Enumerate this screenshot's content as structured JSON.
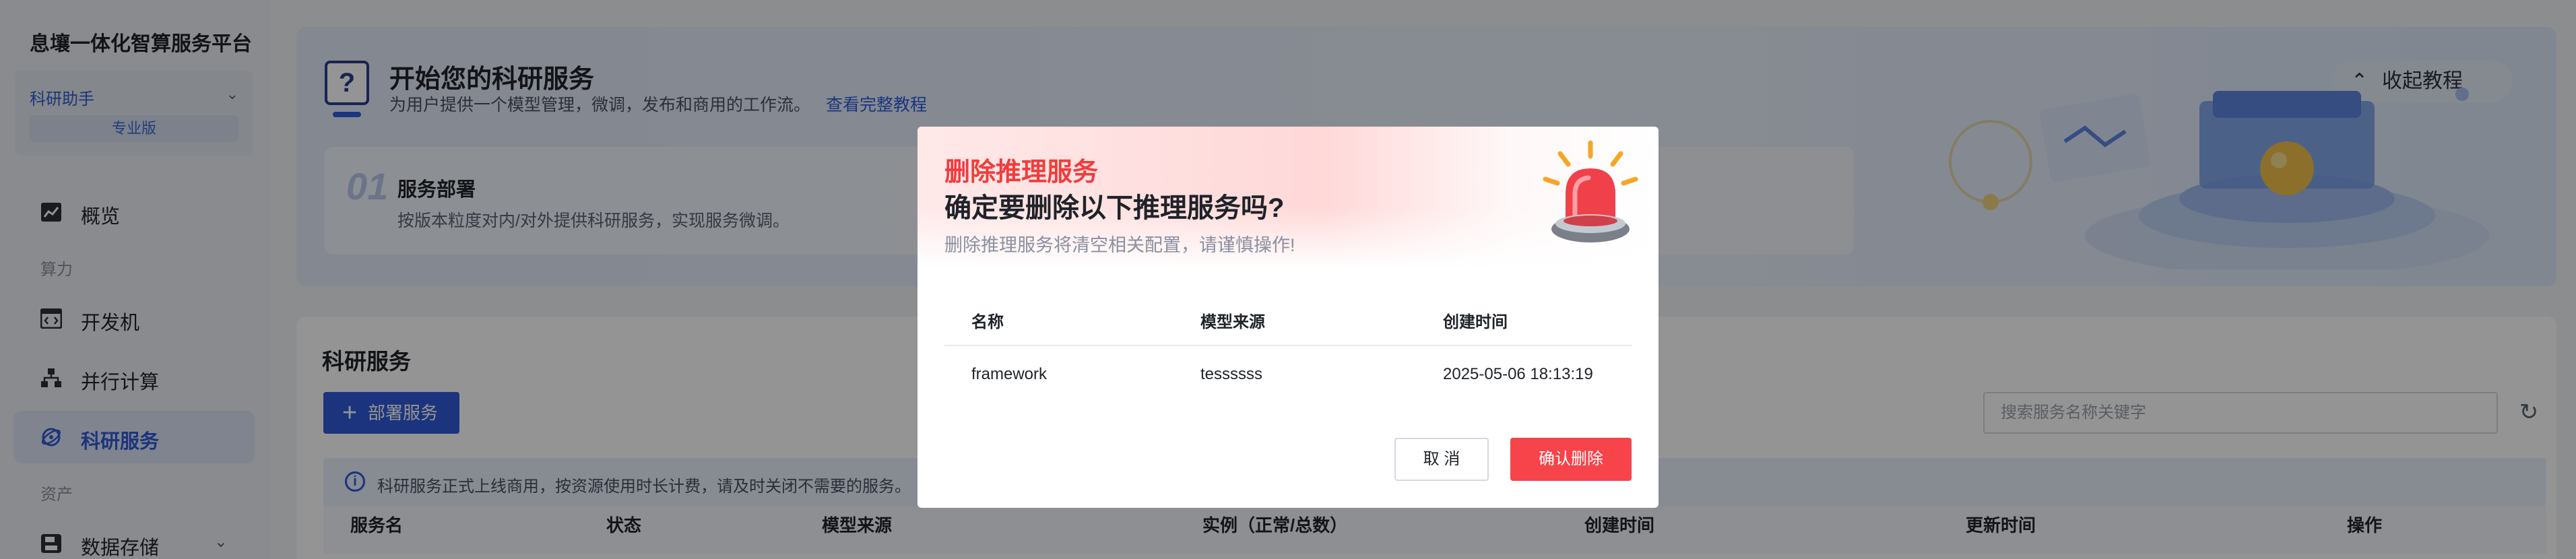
{
  "app": {
    "title": "息壤一体化智算服务平台"
  },
  "workspace": {
    "name": "科研助手",
    "edition": "专业版"
  },
  "sidebar": {
    "items": [
      {
        "label": "概览",
        "icon": "chart-icon"
      },
      {
        "label": "开发机",
        "icon": "code-icon"
      },
      {
        "label": "并行计算",
        "icon": "network-icon"
      },
      {
        "label": "科研服务",
        "icon": "service-icon",
        "active": true
      },
      {
        "label": "数据存储",
        "icon": "disk-icon"
      }
    ],
    "groups": {
      "compute": "算力",
      "assets": "资产"
    }
  },
  "tutorial": {
    "title": "开始您的科研服务",
    "description": "为用户提供一个模型管理，微调，发布和商用的工作流。",
    "link": "查看完整教程",
    "collapse_label": "收起教程",
    "step": {
      "number": "01",
      "title": "服务部署",
      "description": "按版本粒度对内/对外提供科研服务，实现服务微调。"
    }
  },
  "services": {
    "title": "科研服务",
    "deploy_label": "部署服务",
    "search_placeholder": "搜索服务名称关键字",
    "notice": "科研服务正式上线商用，按资源使用时长计费，请及时关闭不需要的服务。",
    "columns": [
      "服务名",
      "状态",
      "模型来源",
      "实例（正常/总数）",
      "创建时间",
      "更新时间",
      "操作"
    ]
  },
  "dialog": {
    "kicker": "删除推理服务",
    "title": "确定要删除以下推理服务吗?",
    "subtitle": "删除推理服务将清空相关配置，请谨慎操作!",
    "columns": [
      "名称",
      "模型来源",
      "创建时间"
    ],
    "rows": [
      {
        "name": "framework",
        "source": "tessssss",
        "created": "2025-05-06 18:13:19"
      }
    ],
    "cancel_label": "取 消",
    "confirm_label": "确认删除",
    "accent": "#f7434a"
  }
}
